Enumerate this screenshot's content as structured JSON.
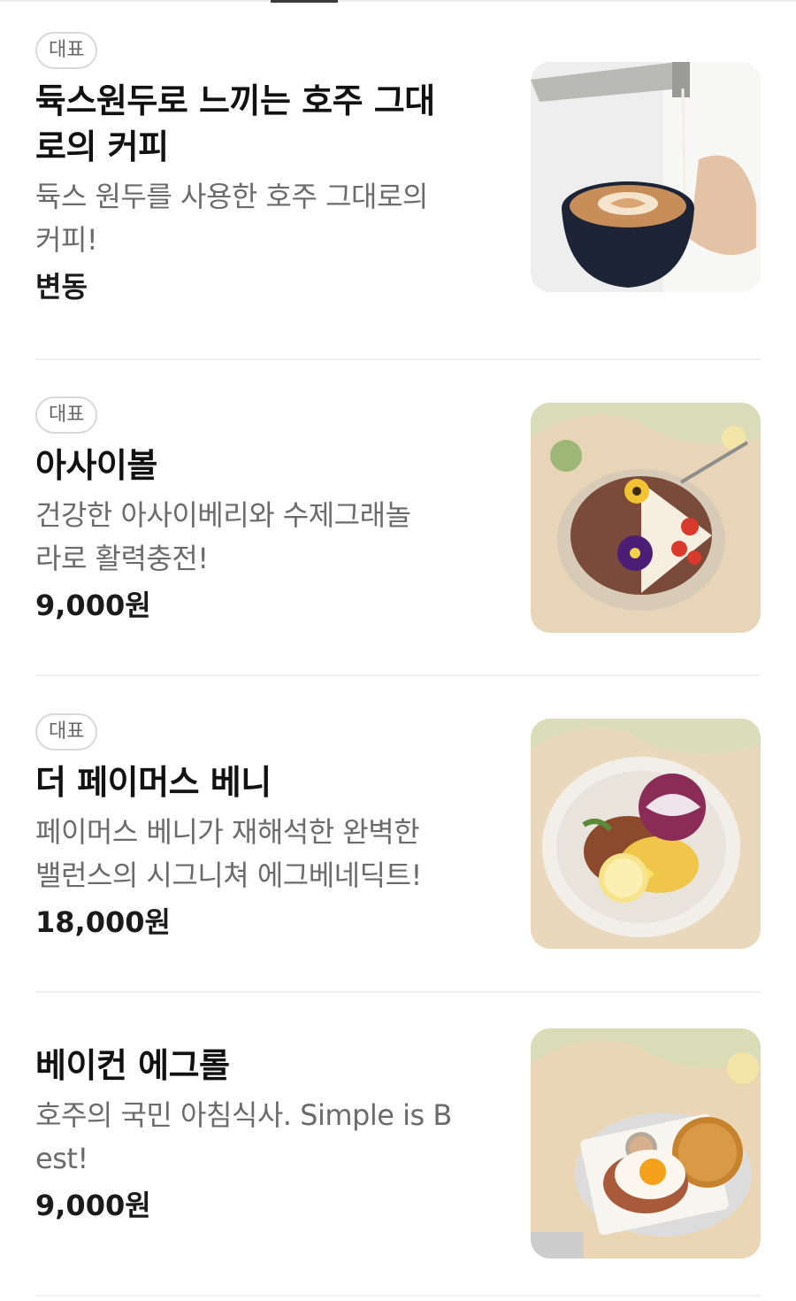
{
  "menu": {
    "items": [
      {
        "badge": "대표",
        "title_lines": [
          "듁스원두로 느끼는 호주 그대",
          "로의 커피"
        ],
        "desc_lines": [
          "듁스 원두를 사용한 호주 그대로의",
          "커피!"
        ],
        "price": "변동",
        "image_icon": "latte-art-photo"
      },
      {
        "badge": "대표",
        "title_lines": [
          "아사이볼"
        ],
        "desc_lines": [
          "건강한 아사이베리와 수제그래놀",
          "라로 활력충전!"
        ],
        "price": "9,000원",
        "image_icon": "acai-bowl-photo"
      },
      {
        "badge": "대표",
        "title_lines": [
          "더 페이머스 베니"
        ],
        "desc_lines": [
          "페이머스 베니가 재해석한 완벽한",
          "밸런스의 시그니쳐 에그베네딕트!"
        ],
        "price": "18,000원",
        "image_icon": "eggs-benedict-photo"
      },
      {
        "badge": "",
        "title_lines": [
          "베이컨 에그롤"
        ],
        "desc_lines": [
          "호주의 국민 아침식사. Simple is B",
          "est!"
        ],
        "price": "9,000원",
        "image_icon": "bacon-egg-roll-photo"
      }
    ]
  }
}
